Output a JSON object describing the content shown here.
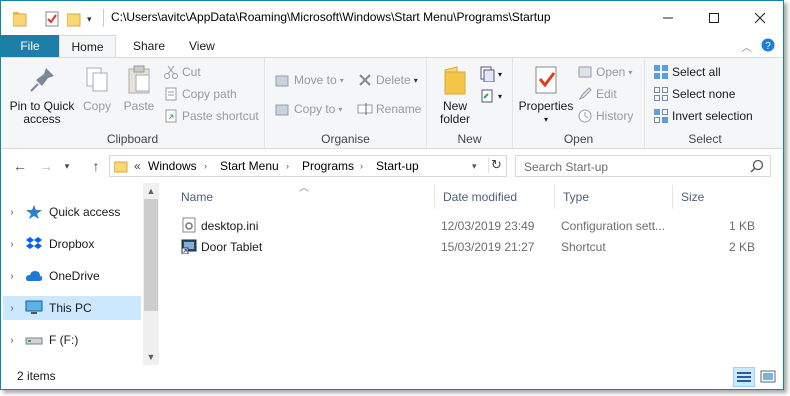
{
  "window": {
    "title": "C:\\Users\\avitc\\AppData\\Roaming\\Microsoft\\Windows\\Start Menu\\Programs\\Startup",
    "accent": "#1d7ea8"
  },
  "tabs": {
    "file": "File",
    "home": "Home",
    "share": "Share",
    "view": "View"
  },
  "ribbon": {
    "clipboard": {
      "label": "Clipboard",
      "pin_line1": "Pin to Quick",
      "pin_line2": "access",
      "copy": "Copy",
      "paste": "Paste",
      "cut": "Cut",
      "copy_path": "Copy path",
      "paste_shortcut": "Paste shortcut"
    },
    "organise": {
      "label": "Organise",
      "move_to": "Move to",
      "copy_to": "Copy to",
      "delete": "Delete",
      "rename": "Rename"
    },
    "new": {
      "label": "New",
      "new_folder_line1": "New",
      "new_folder_line2": "folder"
    },
    "open": {
      "label": "Open",
      "properties": "Properties",
      "open": "Open",
      "edit": "Edit",
      "history": "History"
    },
    "select": {
      "label": "Select",
      "select_all": "Select all",
      "select_none": "Select none",
      "invert": "Invert selection"
    }
  },
  "address": {
    "overflow": "«",
    "crumbs": [
      "Windows",
      "Start Menu",
      "Programs",
      "Start-up"
    ],
    "search_placeholder": "Search Start-up"
  },
  "nav": {
    "items": [
      {
        "label": "Quick access",
        "icon": "star-icon"
      },
      {
        "label": "Dropbox",
        "icon": "dropbox-icon"
      },
      {
        "label": "OneDrive",
        "icon": "cloud-icon"
      },
      {
        "label": "This PC",
        "icon": "monitor-icon",
        "selected": true
      },
      {
        "label": "F (F:)",
        "icon": "drive-icon"
      }
    ]
  },
  "columns": {
    "name": "Name",
    "date": "Date modified",
    "type": "Type",
    "size": "Size"
  },
  "files": [
    {
      "name": "desktop.ini",
      "date": "12/03/2019 23:49",
      "type": "Configuration sett...",
      "size": "1 KB",
      "icon": "config-file-icon"
    },
    {
      "name": "Door Tablet",
      "date": "15/03/2019 21:27",
      "type": "Shortcut",
      "size": "2 KB",
      "icon": "shortcut-icon"
    }
  ],
  "status": {
    "count": "2 items"
  }
}
